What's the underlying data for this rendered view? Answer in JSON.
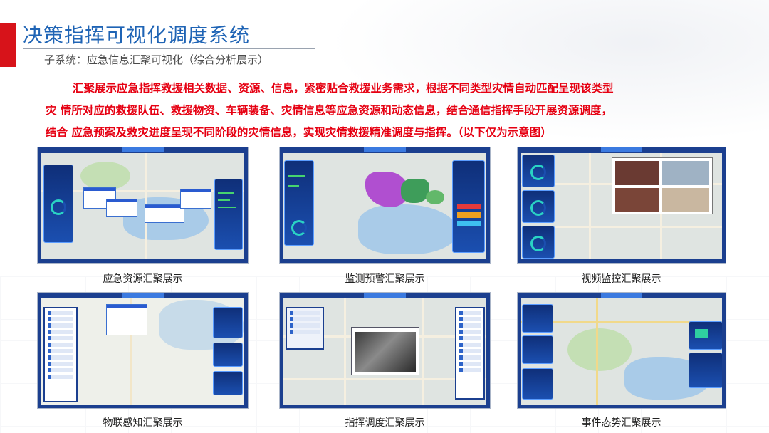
{
  "header": {
    "title": "决策指挥可视化调度系统",
    "subtitle": "子系统：应急信息汇聚可视化（综合分析展示）"
  },
  "description": {
    "line1": "汇聚展示应急指挥救援相关数据、资源、信息，紧密贴合救援业务需求，根据不同类型灾情自动匹配呈现该类型",
    "line2": "灾 情所对应的救援队伍、救援物资、车辆装备、灾情信息等应急资源和动态信息，结合通信指挥手段开展资源调度，",
    "line3": "结合 应急预案及救灾进度呈现不同阶段的灾情信息，实现灾情救援精准调度与指挥。（以下仅为示意图）"
  },
  "panels": [
    {
      "caption": "应急资源汇聚展示"
    },
    {
      "caption": "监测预警汇聚展示"
    },
    {
      "caption": "视频监控汇聚展示"
    },
    {
      "caption": "物联感知汇聚展示"
    },
    {
      "caption": "指挥调度汇聚展示"
    },
    {
      "caption": "事件态势汇聚展示"
    }
  ],
  "colors": {
    "title_blue": "#1f64b5",
    "accent_red": "#d7131a",
    "text_red": "#e60012",
    "dashboard_navy": "#1b3f8f"
  }
}
